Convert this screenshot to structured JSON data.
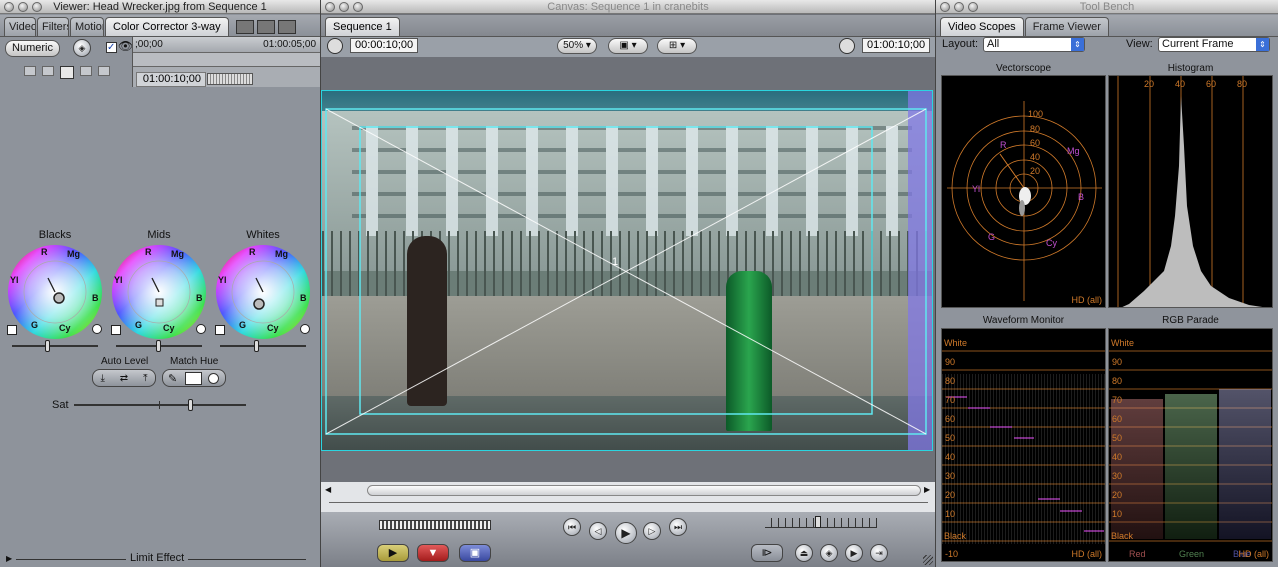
{
  "viewer": {
    "title": "Viewer: Head Wrecker.jpg from Sequence 1",
    "tabs": [
      {
        "label": "Video"
      },
      {
        "label": "Filters"
      },
      {
        "label": "Motion"
      },
      {
        "label": "Color Corrector 3-way"
      }
    ],
    "numeric_label": "Numeric",
    "timeline_start": ";00;00",
    "timeline_end": "01:00:05;00",
    "current_timecode": "01:00:10;00",
    "wheels": [
      {
        "label": "Blacks"
      },
      {
        "label": "Mids"
      },
      {
        "label": "Whites"
      }
    ],
    "wheel_marks": {
      "r": "R",
      "mg": "Mg",
      "yl": "Yl",
      "b": "B",
      "g": "G",
      "cy": "Cy"
    },
    "auto_level_label": "Auto Level",
    "match_hue_label": "Match Hue",
    "sat_label": "Sat",
    "limit_effect_label": "Limit Effect"
  },
  "canvas": {
    "title": "Canvas: Sequence 1 in cranebits",
    "tab": "Sequence 1",
    "timecode_left": "00:00:10;00",
    "zoom": "50%",
    "timecode_right": "01:00:10;00"
  },
  "toolbench": {
    "title": "Tool Bench",
    "tabs": [
      {
        "label": "Video Scopes"
      },
      {
        "label": "Frame Viewer"
      }
    ],
    "layout_label": "Layout:",
    "layout_value": "All",
    "view_label": "View:",
    "view_value": "Current Frame",
    "vectorscope": {
      "title": "Vectorscope",
      "rings": [
        "100",
        "80",
        "60",
        "40",
        "20"
      ],
      "targets": [
        "R",
        "Mg",
        "B",
        "Cy",
        "G",
        "Yl"
      ],
      "footer": "HD (all)"
    },
    "histogram": {
      "title": "Histogram",
      "ticks": [
        "20",
        "40",
        "60",
        "80"
      ]
    },
    "waveform": {
      "title": "Waveform Monitor",
      "white": "White",
      "black": "Black",
      "levels": [
        "90",
        "80",
        "70",
        "60",
        "50",
        "40",
        "30",
        "20",
        "10"
      ],
      "bottom": "-10",
      "footer": "HD (all)"
    },
    "parade": {
      "title": "RGB Parade",
      "white": "White",
      "black": "Black",
      "levels": [
        "90",
        "80",
        "70",
        "60",
        "50",
        "40",
        "30",
        "20",
        "10"
      ],
      "channels": [
        "Red",
        "Green",
        "Blue"
      ],
      "footer": "HD (all)"
    }
  },
  "colors": {
    "accent": "#2bd5e0",
    "wheel_bg": "#8e939b",
    "scope_grid": "#d07a2a"
  },
  "icons": {
    "play": "play-icon",
    "prev": "previous-edit-icon",
    "next": "next-edit-icon",
    "stepback": "step-back-icon",
    "stepfwd": "step-forward-icon"
  }
}
